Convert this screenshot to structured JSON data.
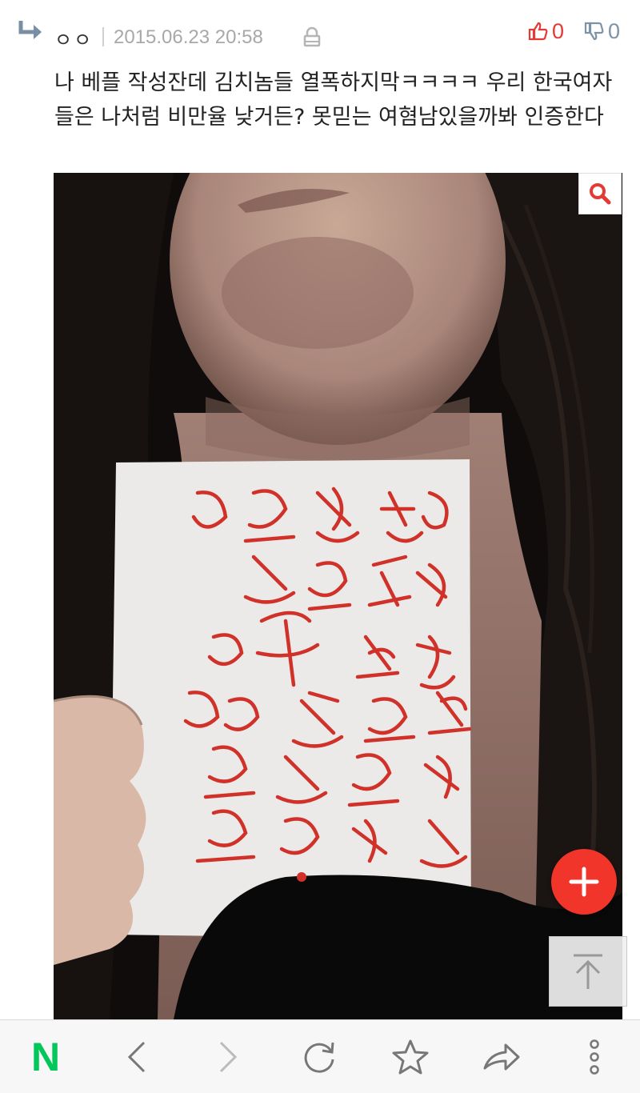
{
  "comment": {
    "author": "ㅇㅇ",
    "datetime": "2015.06.23 20:58",
    "upvotes": "0",
    "downvotes": "0",
    "text": "나 베플 작성잔데 김치놈들 열폭하지막ㅋㅋㅋㅋ 우리 한국여자들은 나처럼 비만율 낮거든? 못믿는 여혐남있을까봐 인증한다"
  },
  "photo": {
    "handwritten_note": "여혐남 꺼져 / 뚱뚱한 여자 없다 / 한국여자 인증 / 비만율 낮다"
  },
  "colors": {
    "upvote": "#e53935",
    "downvote": "#7c93a6",
    "fab": "#f2352a",
    "naver_green": "#03c75a"
  },
  "bottom_bar": {
    "logo": "N",
    "icons": [
      "back-icon",
      "forward-icon",
      "refresh-icon",
      "bookmark-star-icon",
      "share-icon",
      "more-icon"
    ]
  }
}
